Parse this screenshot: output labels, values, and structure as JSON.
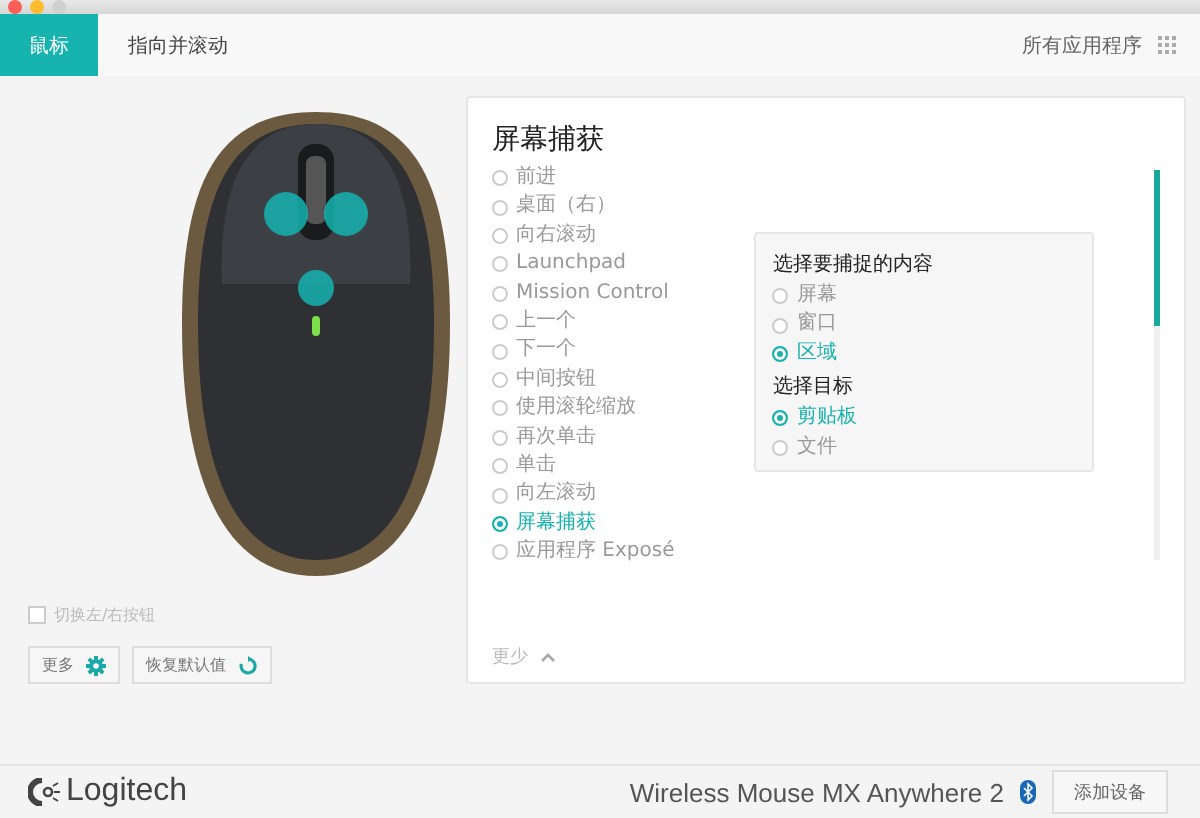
{
  "tabs": [
    {
      "label": "鼠标",
      "selected": true
    },
    {
      "label": "指向并滚动",
      "selected": false
    }
  ],
  "apps_label": "所有应用程序",
  "swap_buttons": {
    "label": "切换左/右按钮",
    "checked": false
  },
  "buttons": [
    {
      "label": "更多",
      "kind": "gear"
    },
    {
      "label": "恢复默认值",
      "kind": "reset"
    }
  ],
  "panel": {
    "title": "屏幕捕获",
    "actions": [
      {
        "label": "前进",
        "selected": false
      },
      {
        "label": "桌面（右）",
        "selected": false
      },
      {
        "label": "向右滚动",
        "selected": false
      },
      {
        "label": "Launchpad",
        "selected": false
      },
      {
        "label": "Mission Control",
        "selected": false
      },
      {
        "label": "上一个",
        "selected": false
      },
      {
        "label": "下一个",
        "selected": false
      },
      {
        "label": "中间按钮",
        "selected": false
      },
      {
        "label": "使用滚轮缩放",
        "selected": false
      },
      {
        "label": "再次单击",
        "selected": false
      },
      {
        "label": "单击",
        "selected": false
      },
      {
        "label": "向左滚动",
        "selected": false
      },
      {
        "label": "屏幕捕获",
        "selected": true
      },
      {
        "label": "应用程序 Exposé",
        "selected": false
      }
    ],
    "less_label": "更少",
    "options": [
      {
        "heading": "选择要捕捉的内容",
        "choices": [
          {
            "label": "屏幕",
            "selected": false
          },
          {
            "label": "窗口",
            "selected": false
          },
          {
            "label": "区域",
            "selected": true
          }
        ]
      },
      {
        "heading": "选择目标",
        "choices": [
          {
            "label": "剪贴板",
            "selected": true
          },
          {
            "label": "文件",
            "selected": false
          }
        ]
      }
    ]
  },
  "footer": {
    "brand": "Logitech",
    "device": "Wireless Mouse MX Anywhere 2",
    "add_button": "添加设备"
  }
}
